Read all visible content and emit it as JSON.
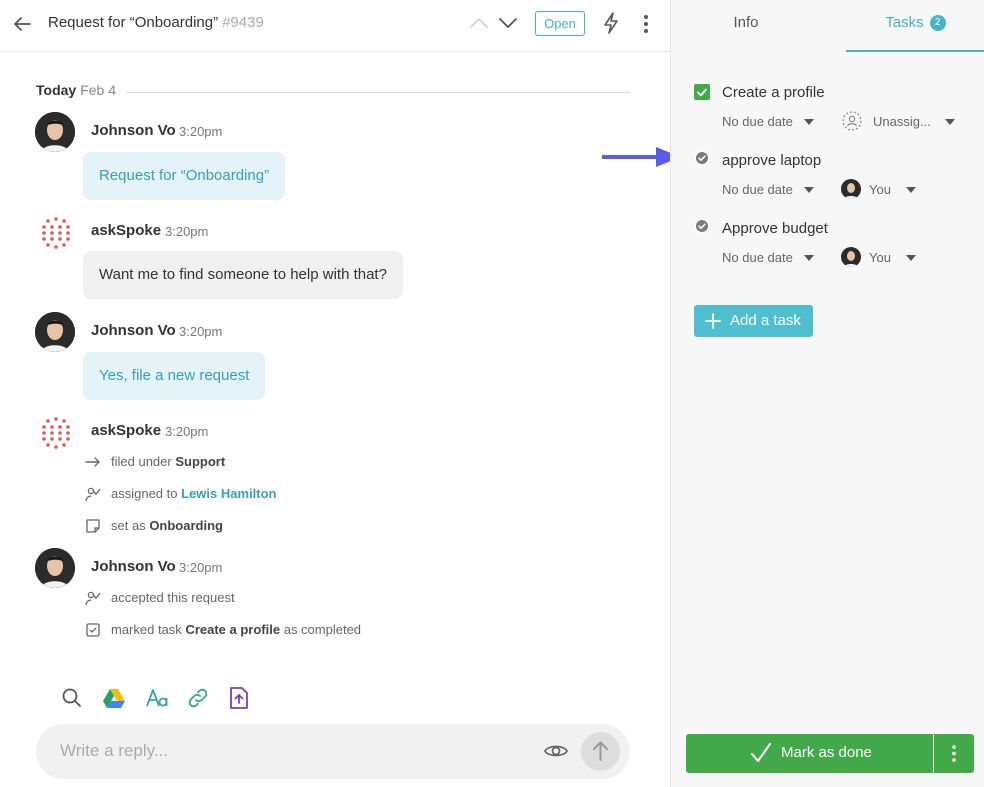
{
  "header": {
    "title": "Request for “Onboarding”",
    "request_number": "#9439",
    "status": "Open"
  },
  "date_separator": {
    "day": "Today",
    "date": "Feb 4"
  },
  "messages": [
    {
      "author": "Johnson Vo",
      "time": "3:20pm",
      "text": "Request for “Onboarding”"
    },
    {
      "author": "askSpoke",
      "time": "3:20pm",
      "text": "Want me to find someone to help with that?"
    },
    {
      "author": "Johnson Vo",
      "time": "3:20pm",
      "text": "Yes, file a new request"
    },
    {
      "author": "askSpoke",
      "time": "3:20pm",
      "activities": [
        {
          "prefix": "filed under",
          "value": "Support"
        },
        {
          "prefix": "assigned to",
          "value": "Lewis Hamilton"
        },
        {
          "prefix": "set as",
          "value": "Onboarding"
        }
      ]
    },
    {
      "author": "Johnson Vo",
      "time": "3:20pm",
      "activities": [
        {
          "text": "accepted this request"
        },
        {
          "prefix": "marked task",
          "value": "Create a profile",
          "suffix": "as completed"
        }
      ]
    }
  ],
  "composer": {
    "placeholder": "Write a reply...",
    "tools": [
      "search-icon",
      "google-drive-icon",
      "text-format-icon",
      "link-icon",
      "file-upload-icon"
    ]
  },
  "sidebar": {
    "tabs": [
      {
        "label": "Info"
      },
      {
        "label": "Tasks",
        "count": "2"
      }
    ],
    "tasks": [
      {
        "title": "Create a profile",
        "completed": true,
        "due": "No due date",
        "assignee": "Unassig..."
      },
      {
        "title": "approve laptop",
        "completed": false,
        "due": "No due date",
        "assignee": "You"
      },
      {
        "title": "Approve budget",
        "completed": false,
        "due": "No due date",
        "assignee": "You"
      }
    ],
    "add_task_label": "Add a task",
    "mark_done_label": "Mark as done"
  },
  "colors": {
    "accent": "#45b5c4",
    "success": "#42a94b",
    "annotation_arrow": "#5a5ee6"
  }
}
